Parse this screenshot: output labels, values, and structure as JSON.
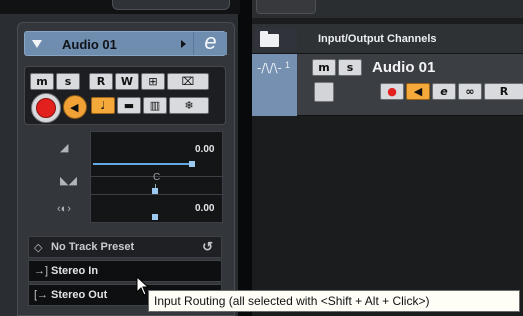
{
  "inspector": {
    "track_name": "Audio 01",
    "edit_button": "e",
    "buttons_row1": [
      "m",
      "s",
      "R",
      "W",
      "⊞",
      "⌧"
    ],
    "buttons_row2_icons": [
      "record",
      "monitor",
      "note",
      "time-base",
      "lanes",
      "freeze"
    ],
    "volume_value": "0.00",
    "pan_value": "C",
    "delay_value": "0.00",
    "track_preset": "No Track Preset",
    "input_routing": "Stereo In",
    "output_routing": "Stereo Out"
  },
  "tracklist": {
    "header_title": "Input/Output Channels",
    "track": {
      "number": "1",
      "name": "Audio 01",
      "buttons": [
        "m",
        "s"
      ],
      "edit_button": "e"
    }
  },
  "tooltip": {
    "text": "Input Routing (all selected with <Shift + Alt + Click>)"
  },
  "colors": {
    "track_color": "#6f8daf",
    "record": "#e2201e",
    "monitor": "#f1a236",
    "volume_line": "#63a9e3"
  }
}
